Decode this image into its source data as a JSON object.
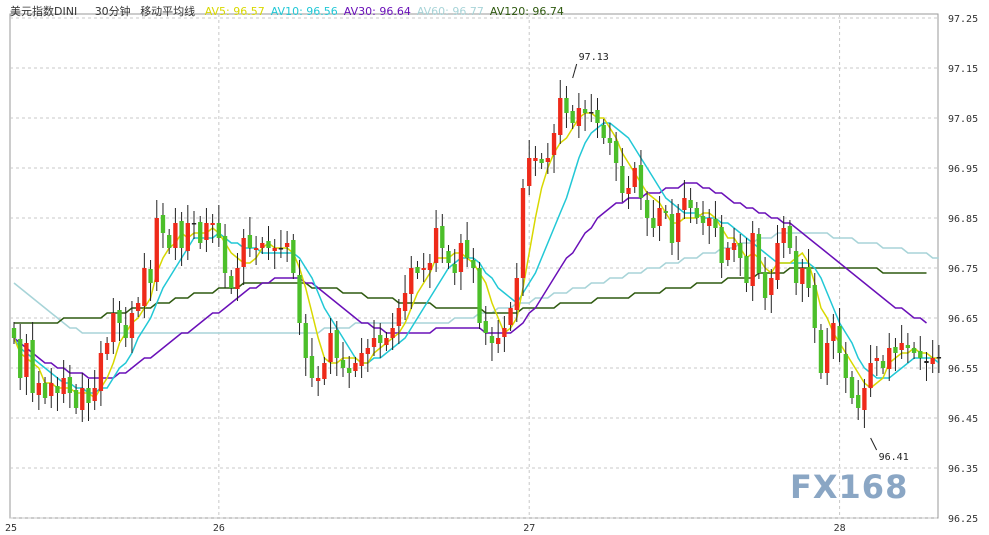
{
  "chart_data": {
    "type": "candlestick",
    "title": "美元指数DINI",
    "interval": "30分钟",
    "indicator": "移动平均线",
    "legend": [
      {
        "name": "AV5",
        "value": "96.57",
        "color": "#d8d800"
      },
      {
        "name": "AV10",
        "value": "96.56",
        "color": "#22c8d6"
      },
      {
        "name": "AV30",
        "value": "96.64",
        "color": "#6a10b8"
      },
      {
        "name": "AV60",
        "value": "96.77",
        "color": "#a8d4d8"
      },
      {
        "name": "AV120",
        "value": "96.74",
        "color": "#2f5a10"
      }
    ],
    "ylim": [
      96.25,
      97.25
    ],
    "yticks": [
      "97.25",
      "97.15",
      "97.05",
      "96.95",
      "96.85",
      "96.75",
      "96.65",
      "96.55",
      "96.45",
      "96.35",
      "96.25"
    ],
    "x_labels": [
      {
        "label": "25",
        "index": 0
      },
      {
        "label": "26",
        "index": 33
      },
      {
        "label": "27",
        "index": 83
      },
      {
        "label": "28",
        "index": 133
      }
    ],
    "annotations": [
      {
        "text": "97.13",
        "index": 90,
        "value": 97.13
      },
      {
        "text": "96.41",
        "index": 138,
        "value": 96.41
      }
    ],
    "colors": {
      "up": "#ee2a1a",
      "down": "#4cbf2a",
      "doji": "#222222",
      "grid": "#c8c8c8"
    },
    "closes": [
      96.61,
      96.53,
      96.6,
      96.5,
      96.52,
      96.49,
      96.52,
      96.5,
      96.53,
      96.5,
      96.47,
      96.51,
      96.48,
      96.51,
      96.58,
      96.6,
      96.66,
      96.64,
      96.61,
      96.66,
      96.68,
      96.75,
      96.72,
      96.85,
      96.82,
      96.79,
      96.84,
      96.79,
      96.84,
      96.84,
      96.8,
      96.84,
      96.84,
      96.81,
      96.74,
      96.71,
      96.75,
      96.81,
      96.79,
      96.79,
      96.8,
      96.79,
      96.79,
      96.79,
      96.8,
      96.74,
      96.64,
      96.57,
      96.53,
      96.53,
      96.56,
      96.62,
      96.57,
      96.55,
      96.54,
      96.56,
      96.58,
      96.59,
      96.61,
      96.6,
      96.61,
      96.63,
      96.67,
      96.7,
      96.75,
      96.74,
      96.75,
      96.76,
      96.83,
      96.79,
      96.76,
      96.74,
      96.8,
      96.77,
      96.75,
      96.64,
      96.62,
      96.6,
      96.61,
      96.63,
      96.67,
      96.73,
      96.91,
      96.97,
      96.97,
      96.96,
      96.97,
      97.02,
      97.09,
      97.06,
      97.04,
      97.07,
      97.06,
      97.06,
      97.04,
      97.01,
      97.0,
      96.96,
      96.9,
      96.91,
      96.95,
      96.89,
      96.85,
      96.83,
      96.87,
      96.86,
      96.8,
      96.86,
      96.89,
      96.87,
      96.85,
      96.84,
      96.85,
      96.83,
      96.76,
      96.79,
      96.8,
      96.77,
      96.72,
      96.82,
      96.74,
      96.69,
      96.73,
      96.8,
      96.83,
      96.79,
      96.72,
      96.75,
      96.71,
      96.63,
      96.54,
      96.6,
      96.64,
      96.58,
      96.53,
      96.49,
      96.47,
      96.51,
      96.56,
      96.57,
      96.55,
      96.59,
      96.58,
      96.6,
      96.59,
      96.58,
      96.57,
      96.56,
      96.57,
      96.57
    ],
    "series": [
      {
        "name": "AV5",
        "values": [
          96.61,
          96.58,
          96.57,
          96.56,
          96.55,
          96.52,
          96.52,
          96.51,
          96.51,
          96.51,
          96.5,
          96.5,
          96.5,
          96.49,
          96.51,
          96.53,
          96.56,
          96.6,
          96.62,
          96.64,
          96.65,
          96.67,
          96.69,
          96.74,
          96.77,
          96.79,
          96.8,
          96.82,
          96.81,
          96.82,
          96.82,
          96.82,
          96.83,
          96.82,
          96.8,
          96.78,
          96.77,
          96.76,
          96.76,
          96.77,
          96.79,
          96.8,
          96.79,
          96.79,
          96.79,
          96.78,
          96.75,
          96.71,
          96.66,
          96.61,
          96.57,
          96.56,
          96.56,
          96.57,
          96.57,
          96.57,
          96.56,
          96.56,
          96.58,
          96.59,
          96.6,
          96.61,
          96.62,
          96.64,
          96.67,
          96.7,
          96.72,
          96.74,
          96.77,
          96.77,
          96.77,
          96.78,
          96.78,
          96.77,
          96.76,
          96.74,
          96.72,
          96.68,
          96.65,
          96.62,
          96.63,
          96.65,
          96.71,
          96.78,
          96.85,
          96.91,
          96.95,
          96.98,
          97.0,
          97.01,
          97.03,
          97.05,
          97.06,
          97.06,
          97.05,
          97.05,
          97.03,
          97.01,
          96.98,
          96.96,
          96.94,
          96.92,
          96.9,
          96.89,
          96.88,
          96.86,
          96.84,
          96.84,
          96.85,
          96.85,
          96.85,
          96.86,
          96.86,
          96.85,
          96.83,
          96.81,
          96.81,
          96.79,
          96.77,
          96.78,
          96.77,
          96.75,
          96.74,
          96.76,
          96.76,
          96.76,
          96.77,
          96.78,
          96.76,
          96.72,
          96.67,
          96.65,
          96.62,
          96.6,
          96.58,
          96.56,
          96.54,
          96.52,
          96.51,
          96.52,
          96.53,
          96.56,
          96.57,
          96.58,
          96.58,
          96.59,
          96.58,
          96.58,
          96.57,
          96.57
        ]
      },
      {
        "name": "AV10",
        "values": [
          96.61,
          96.59,
          96.58,
          96.57,
          96.56,
          96.55,
          96.54,
          96.53,
          96.52,
          96.52,
          96.51,
          96.51,
          96.5,
          96.5,
          96.51,
          96.51,
          96.53,
          96.55,
          96.56,
          96.58,
          96.61,
          96.63,
          96.65,
          96.68,
          96.71,
          96.73,
          96.75,
          96.77,
          96.79,
          96.81,
          96.81,
          96.81,
          96.81,
          96.82,
          96.81,
          96.8,
          96.8,
          96.79,
          96.79,
          96.79,
          96.78,
          96.78,
          96.78,
          96.78,
          96.78,
          96.78,
          96.77,
          96.75,
          96.73,
          96.7,
          96.67,
          96.65,
          96.63,
          96.61,
          96.59,
          96.57,
          96.56,
          96.56,
          96.57,
          96.57,
          96.58,
          96.59,
          96.6,
          96.61,
          96.63,
          96.65,
          96.67,
          96.69,
          96.71,
          96.73,
          96.75,
          96.76,
          96.77,
          96.77,
          96.77,
          96.76,
          96.74,
          96.73,
          96.71,
          96.7,
          96.69,
          96.68,
          96.7,
          96.72,
          96.74,
          96.77,
          96.8,
          96.83,
          96.86,
          96.89,
          96.93,
          96.97,
          97.0,
          97.02,
          97.03,
          97.04,
          97.04,
          97.03,
          97.02,
          97.01,
          96.99,
          96.97,
          96.95,
          96.93,
          96.91,
          96.89,
          96.88,
          96.87,
          96.86,
          96.86,
          96.86,
          96.85,
          96.85,
          96.85,
          96.84,
          96.84,
          96.83,
          96.82,
          96.81,
          96.8,
          96.79,
          96.78,
          96.77,
          96.76,
          96.76,
          96.76,
          96.76,
          96.76,
          96.76,
          96.75,
          96.73,
          96.7,
          96.67,
          96.64,
          96.62,
          96.6,
          96.57,
          96.55,
          96.54,
          96.53,
          96.53,
          96.53,
          96.54,
          96.55,
          96.56,
          96.57,
          96.57,
          96.57,
          96.57,
          96.56
        ]
      },
      {
        "name": "AV30",
        "values": [
          96.61,
          96.6,
          96.59,
          96.58,
          96.57,
          96.56,
          96.56,
          96.55,
          96.55,
          96.54,
          96.54,
          96.54,
          96.53,
          96.53,
          96.53,
          96.53,
          96.53,
          96.54,
          96.54,
          96.55,
          96.56,
          96.57,
          96.57,
          96.58,
          96.59,
          96.6,
          96.61,
          96.62,
          96.62,
          96.63,
          96.64,
          96.65,
          96.66,
          96.66,
          96.67,
          96.68,
          96.69,
          96.7,
          96.71,
          96.71,
          96.72,
          96.72,
          96.73,
          96.73,
          96.73,
          96.73,
          96.73,
          96.72,
          96.72,
          96.71,
          96.7,
          96.69,
          96.68,
          96.67,
          96.66,
          96.65,
          96.64,
          96.64,
          96.63,
          96.63,
          96.62,
          96.62,
          96.62,
          96.62,
          96.62,
          96.62,
          96.62,
          96.62,
          96.63,
          96.63,
          96.63,
          96.63,
          96.63,
          96.63,
          96.63,
          96.63,
          96.62,
          96.62,
          96.62,
          96.62,
          96.62,
          96.63,
          96.64,
          96.66,
          96.67,
          96.69,
          96.71,
          96.73,
          96.75,
          96.77,
          96.78,
          96.8,
          96.82,
          96.83,
          96.85,
          96.86,
          96.87,
          96.88,
          96.88,
          96.89,
          96.89,
          96.89,
          96.9,
          96.9,
          96.9,
          96.91,
          96.91,
          96.91,
          96.92,
          96.92,
          96.92,
          96.91,
          96.91,
          96.9,
          96.9,
          96.89,
          96.88,
          96.88,
          96.87,
          96.87,
          96.86,
          96.86,
          96.85,
          96.85,
          96.84,
          96.84,
          96.83,
          96.82,
          96.81,
          96.8,
          96.79,
          96.78,
          96.77,
          96.76,
          96.75,
          96.74,
          96.73,
          96.72,
          96.71,
          96.7,
          96.69,
          96.68,
          96.67,
          96.67,
          96.66,
          96.65,
          96.65,
          96.64
        ]
      },
      {
        "name": "AV60",
        "values": [
          96.72,
          96.71,
          96.7,
          96.69,
          96.68,
          96.67,
          96.66,
          96.65,
          96.64,
          96.63,
          96.63,
          96.62,
          96.62,
          96.62,
          96.62,
          96.62,
          96.62,
          96.62,
          96.62,
          96.62,
          96.62,
          96.62,
          96.62,
          96.62,
          96.62,
          96.62,
          96.62,
          96.62,
          96.62,
          96.62,
          96.62,
          96.62,
          96.62,
          96.62,
          96.62,
          96.62,
          96.62,
          96.62,
          96.62,
          96.62,
          96.62,
          96.62,
          96.62,
          96.62,
          96.62,
          96.62,
          96.62,
          96.62,
          96.62,
          96.62,
          96.63,
          96.63,
          96.63,
          96.63,
          96.63,
          96.64,
          96.64,
          96.64,
          96.64,
          96.64,
          96.64,
          96.64,
          96.64,
          96.64,
          96.64,
          96.64,
          96.64,
          96.64,
          96.64,
          96.64,
          96.64,
          96.65,
          96.65,
          96.65,
          96.65,
          96.66,
          96.66,
          96.66,
          96.67,
          96.67,
          96.67,
          96.68,
          96.68,
          96.68,
          96.69,
          96.69,
          96.69,
          96.7,
          96.7,
          96.7,
          96.71,
          96.71,
          96.71,
          96.72,
          96.72,
          96.72,
          96.73,
          96.73,
          96.73,
          96.74,
          96.74,
          96.74,
          96.75,
          96.75,
          96.75,
          96.76,
          96.76,
          96.76,
          96.77,
          96.77,
          96.77,
          96.78,
          96.78,
          96.78,
          96.79,
          96.79,
          96.79,
          96.8,
          96.8,
          96.8,
          96.81,
          96.81,
          96.81,
          96.82,
          96.82,
          96.82,
          96.82,
          96.82,
          96.82,
          96.82,
          96.82,
          96.82,
          96.81,
          96.81,
          96.81,
          96.81,
          96.8,
          96.8,
          96.8,
          96.8,
          96.79,
          96.79,
          96.79,
          96.79,
          96.78,
          96.78,
          96.78,
          96.78,
          96.77,
          96.77
        ]
      },
      {
        "name": "AV120",
        "values": [
          96.64,
          96.64,
          96.64,
          96.64,
          96.64,
          96.64,
          96.64,
          96.64,
          96.65,
          96.65,
          96.65,
          96.65,
          96.65,
          96.65,
          96.65,
          96.66,
          96.66,
          96.66,
          96.66,
          96.67,
          96.67,
          96.67,
          96.67,
          96.68,
          96.68,
          96.68,
          96.69,
          96.69,
          96.69,
          96.7,
          96.7,
          96.7,
          96.7,
          96.71,
          96.71,
          96.71,
          96.71,
          96.72,
          96.72,
          96.72,
          96.72,
          96.72,
          96.72,
          96.72,
          96.72,
          96.72,
          96.72,
          96.72,
          96.71,
          96.71,
          96.71,
          96.71,
          96.71,
          96.7,
          96.7,
          96.7,
          96.7,
          96.69,
          96.69,
          96.69,
          96.69,
          96.69,
          96.68,
          96.68,
          96.68,
          96.68,
          96.68,
          96.68,
          96.67,
          96.67,
          96.67,
          96.67,
          96.67,
          96.67,
          96.67,
          96.67,
          96.66,
          96.66,
          96.66,
          96.66,
          96.66,
          96.66,
          96.67,
          96.67,
          96.67,
          96.67,
          96.67,
          96.67,
          96.68,
          96.68,
          96.68,
          96.68,
          96.68,
          96.68,
          96.69,
          96.69,
          96.69,
          96.69,
          96.69,
          96.69,
          96.7,
          96.7,
          96.7,
          96.7,
          96.7,
          96.71,
          96.71,
          96.71,
          96.71,
          96.71,
          96.72,
          96.72,
          96.72,
          96.72,
          96.72,
          96.73,
          96.73,
          96.73,
          96.73,
          96.73,
          96.74,
          96.74,
          96.74,
          96.74,
          96.74,
          96.75,
          96.75,
          96.75,
          96.75,
          96.75,
          96.75,
          96.75,
          96.75,
          96.75,
          96.75,
          96.75,
          96.75,
          96.75,
          96.75,
          96.75,
          96.74,
          96.74,
          96.74,
          96.74,
          96.74,
          96.74,
          96.74,
          96.74
        ]
      }
    ]
  },
  "logo": {
    "text": "FX168"
  }
}
